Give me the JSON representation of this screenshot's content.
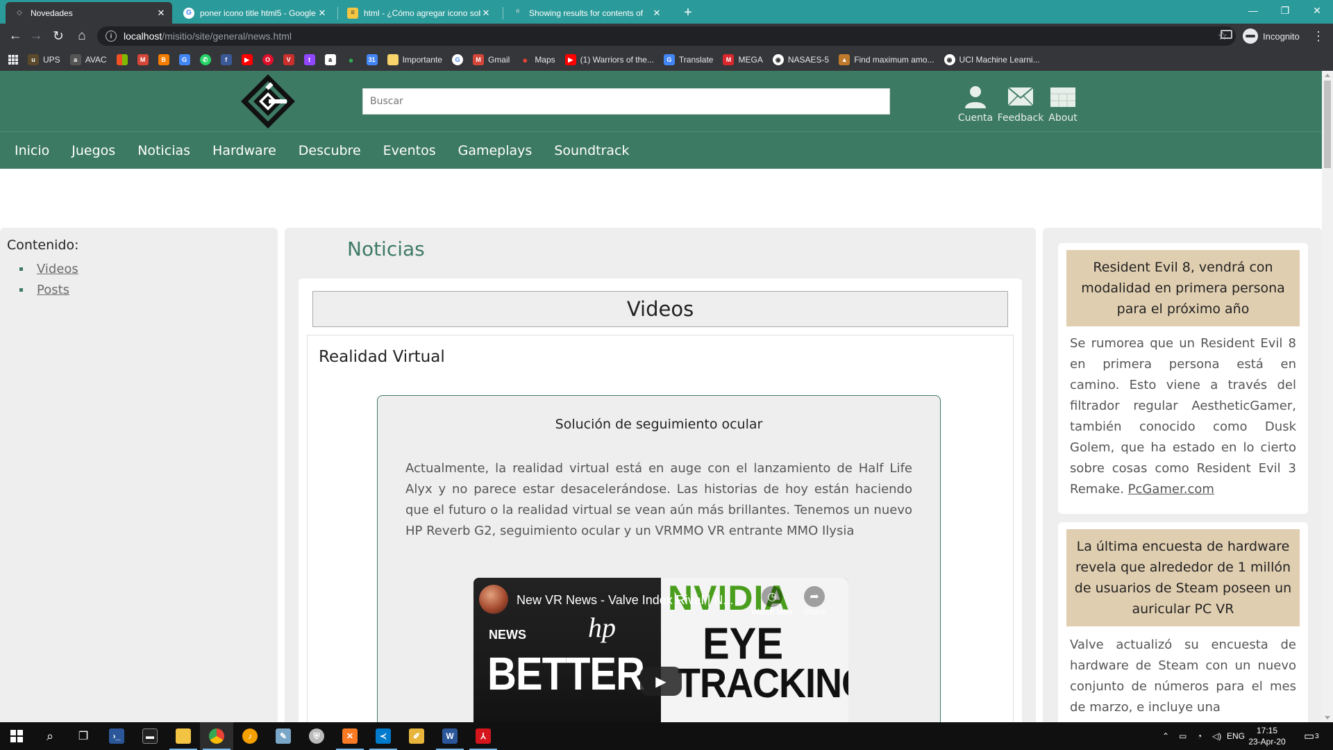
{
  "browser": {
    "tabs": [
      {
        "title": "Novedades",
        "active": true
      },
      {
        "title": "poner icono title html5 - Google",
        "active": false
      },
      {
        "title": "html - ¿Cómo agregar icono sob",
        "active": false
      },
      {
        "title": "Showing results for contents of",
        "active": false
      }
    ],
    "new_tab": "+",
    "url_host": "localhost",
    "url_path": "/misitio/site/general/news.html",
    "profile": "Incognito",
    "bookmarks": [
      "UPS",
      "AVAC",
      "Importante",
      "Gmail",
      "Maps",
      "(1) Warriors of the...",
      "Translate",
      "MEGA",
      "NASAES-5",
      "Find maximum amo...",
      "UCI Machine Learni..."
    ]
  },
  "header": {
    "search_placeholder": "Buscar",
    "icons": [
      {
        "label": "Cuenta",
        "icon": "user-icon"
      },
      {
        "label": "Feedback",
        "icon": "mail-icon"
      },
      {
        "label": "About",
        "icon": "grid-icon"
      }
    ],
    "nav": [
      "Inicio",
      "Juegos",
      "Noticias",
      "Hardware",
      "Descubre",
      "Eventos",
      "Gameplays",
      "Soundtrack"
    ],
    "brand_color": "#3d7a64"
  },
  "sidebar": {
    "heading": "Contenido:",
    "links": [
      "Videos",
      "Posts"
    ]
  },
  "main": {
    "title": "Noticias",
    "section": "Videos",
    "subsection": "Realidad Virtual",
    "article": {
      "title": "Solución de seguimiento ocular",
      "body": "Actualmente, la realidad virtual está en auge con el lanzamiento de Half Life Alyx y no parece estar desacelerándose. Las historias de hoy están haciendo que el futuro o la realidad virtual se vean aún más brillantes. Tenemos un nuevo HP Reverb G2, seguimiento ocular y un VRMMO VR entrante MMO Ilysia"
    },
    "video": {
      "title": "New VR News - Valve Index Rival | N...",
      "watch_later": "Watch later",
      "share": "Share",
      "thumb_text": {
        "news": "NEWS",
        "hp": "hp",
        "better": "BETTER",
        "nvidia": "NVIDIA",
        "eye": "EYE",
        "tracking": "TRACKING"
      }
    }
  },
  "right": {
    "cards": [
      {
        "headline": "Resident Evil 8, vendrá con modalidad en primera persona para el próximo año",
        "body": "Se rumorea que un Resident Evil 8 en primera persona está en camino. Esto viene a través del filtrador regular AestheticGamer, también conocido como Dusk Golem, que ha estado en lo cierto sobre cosas como Resident Evil 3 Remake.",
        "link": "PcGamer.com"
      },
      {
        "headline": "La última encuesta de hardware revela que alrededor de 1 millón de usuarios de Steam poseen un auricular PC VR",
        "body": "Valve actualizó su encuesta de hardware de Steam con un nuevo conjunto de números para el mes de marzo, e incluye una"
      }
    ]
  },
  "taskbar": {
    "lang": "ENG",
    "time": "17:15",
    "date": "23-Apr-20",
    "notifications": "3"
  }
}
